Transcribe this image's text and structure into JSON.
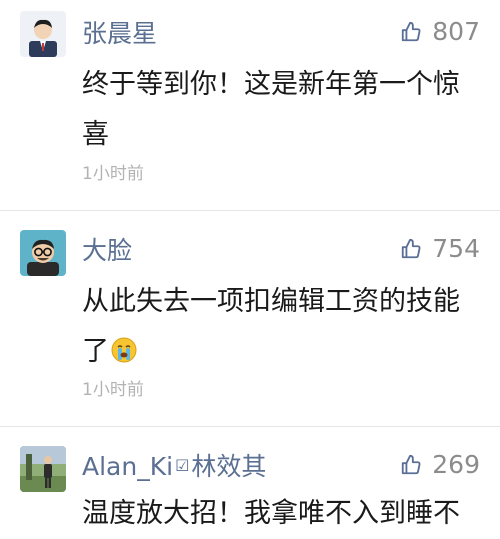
{
  "comments": [
    {
      "username": "张晨星",
      "likes": "807",
      "text_line1": "终于等到你！这是新年第一个惊",
      "text_line2": "喜",
      "time": "1小时前",
      "avatar": "man-in-suit-avatar"
    },
    {
      "username": "大脸",
      "likes": "754",
      "text_line1": "从此失去一项扣编辑工资的技能",
      "text_line2": "了",
      "time": "1小时前",
      "avatar": "man-with-glasses-avatar",
      "emoji": "crying-face-emoji"
    },
    {
      "username": "Alan_Ki",
      "verified_mark": "☑",
      "username_suffix": "林效其",
      "likes": "269",
      "text_line1": "温度放大招！我拿唯不入到睡不",
      "avatar": "outdoor-photo-avatar"
    }
  ],
  "icons": {
    "like": "thumbs-up-icon"
  },
  "colors": {
    "username": "#5a6f92",
    "text": "#1a1a1a",
    "meta": "#b3b3b3",
    "likes": "#8c8c8c"
  }
}
